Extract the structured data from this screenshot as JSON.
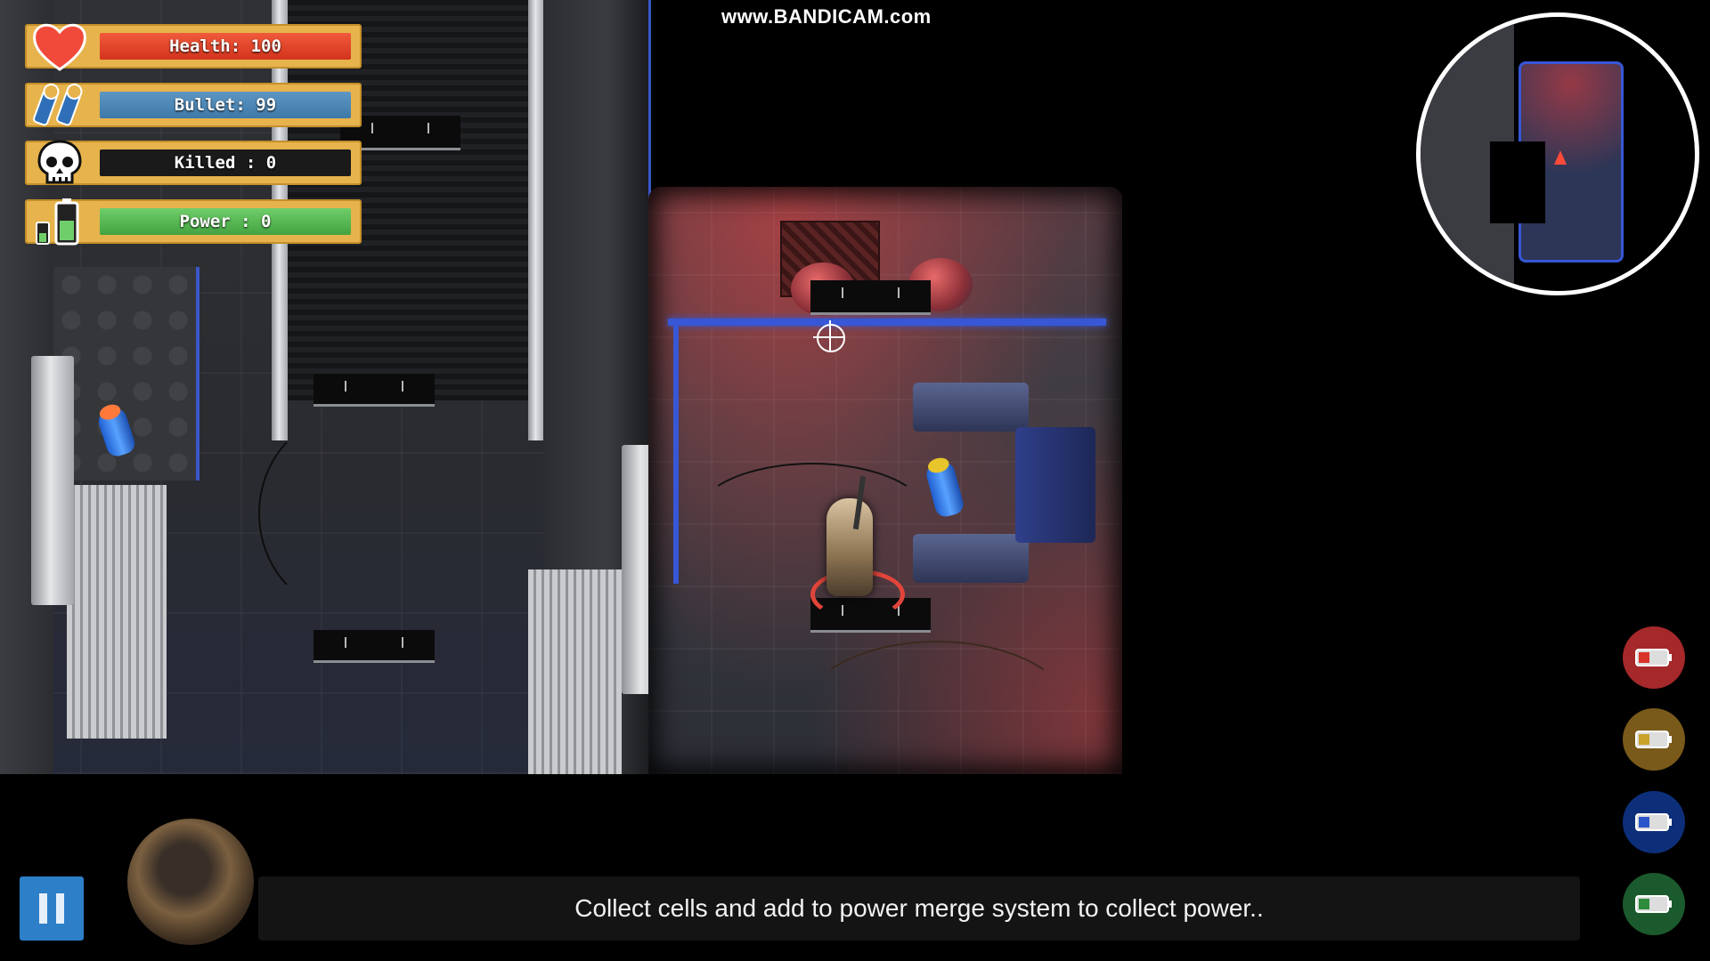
{
  "watermark": "www.BANDICAM.com",
  "hud": {
    "health": {
      "label": "Health: 100",
      "icon": "heart-icon"
    },
    "bullet": {
      "label": "Bullet: 99",
      "icon": "bullets-icon"
    },
    "killed": {
      "label": "Killed : 0",
      "icon": "skull-icon"
    },
    "power": {
      "label": "Power : 0",
      "icon": "battery-icon"
    }
  },
  "minimap": {
    "player_marker": "red-arrow"
  },
  "merge_buttons": [
    {
      "color": "red",
      "hex": "#a5282a"
    },
    {
      "color": "yellow",
      "hex": "#7a5a1a"
    },
    {
      "color": "blue",
      "hex": "#0d2f7a"
    },
    {
      "color": "green",
      "hex": "#1b5a2c"
    }
  ],
  "pickups": [
    {
      "type": "cell",
      "cap_color": "#ff7a3a"
    },
    {
      "type": "cell",
      "cap_color": "#e8c52a"
    }
  ],
  "message": "Collect cells and add to power merge system to collect power..",
  "colors": {
    "accent_blue": "#3757d6",
    "hud_frame": "#e7b34c"
  }
}
